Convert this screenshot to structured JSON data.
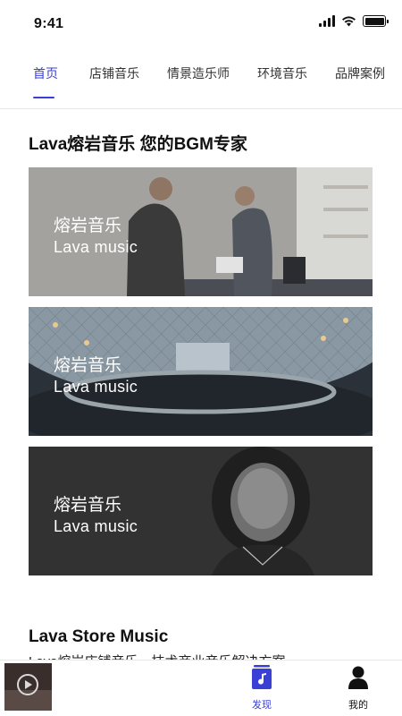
{
  "status_bar": {
    "time": "9:41"
  },
  "tabs": [
    {
      "label": "首页",
      "active": true
    },
    {
      "label": "店铺音乐"
    },
    {
      "label": "情景造乐师"
    },
    {
      "label": "环境音乐"
    },
    {
      "label": "品牌案例"
    }
  ],
  "section1": {
    "title": "Lava熔岩音乐 您的BGM专家",
    "cards": [
      {
        "cn": "熔岩音乐",
        "en": "Lava music"
      },
      {
        "cn": "熔岩音乐",
        "en": "Lava music"
      },
      {
        "cn": "熔岩音乐",
        "en": "Lava music"
      }
    ]
  },
  "section2": {
    "title": "Lava Store Music",
    "desc": "Lava熔岩店铺音乐，技术商业音乐解决方案"
  },
  "bottom_nav": {
    "discover": "发现",
    "mine": "我的"
  },
  "colors": {
    "accent": "#3a3fd6"
  }
}
